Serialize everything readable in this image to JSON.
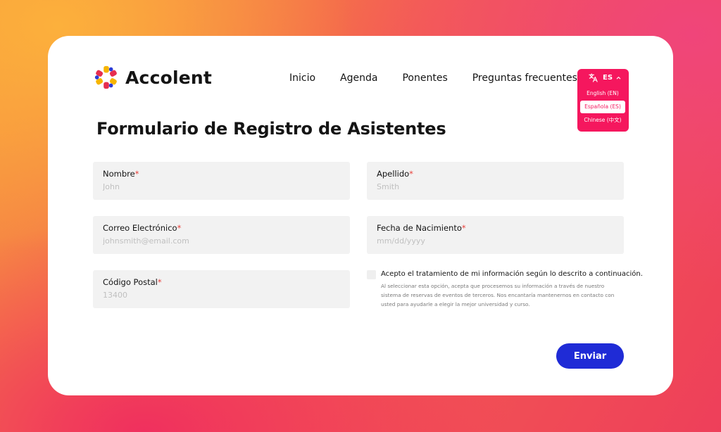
{
  "brand": {
    "name": "Accolent",
    "colors": [
      "#f7b500",
      "#e62e4f",
      "#2b3bd6",
      "#f5175e"
    ]
  },
  "nav": {
    "items": [
      "Inicio",
      "Agenda",
      "Ponentes",
      "Preguntas frecuentes"
    ]
  },
  "language": {
    "current": "ES",
    "icon": "translate-icon",
    "options": [
      {
        "label": "English (EN)",
        "selected": false
      },
      {
        "label": "Española (ES)",
        "selected": true
      },
      {
        "label": "Chinese (中文)",
        "selected": false
      }
    ]
  },
  "form": {
    "title": "Formulario de Registro de Asistentes",
    "required_mark": "*",
    "fields": {
      "first_name": {
        "label": "Nombre",
        "placeholder": "John"
      },
      "last_name": {
        "label": "Apellido",
        "placeholder": "Smith"
      },
      "email": {
        "label": "Correo Electrónico",
        "placeholder": "johnsmith@email.com"
      },
      "birthdate": {
        "label": "Fecha de Nacimiento",
        "placeholder": "mm/dd/yyyy"
      },
      "postal_code": {
        "label": "Código Postal",
        "placeholder": "13400"
      }
    },
    "consent": {
      "label": "Acepto el tratamiento de mi información según lo descrito a continuación.",
      "description": "Al seleccionar esta opción, acepta que procesemos su información a través de nuestro sistema de reservas de eventos de terceros. Nos encantaría mantenernos en contacto con usted para ayudarle a elegir la mejor universidad y curso.",
      "checked": false
    },
    "submit_label": "Enviar"
  },
  "theme": {
    "accent": "#1f2bd6",
    "language_bg": "#f5175e",
    "required": "#e8403a",
    "field_bg": "#f2f2f2"
  }
}
